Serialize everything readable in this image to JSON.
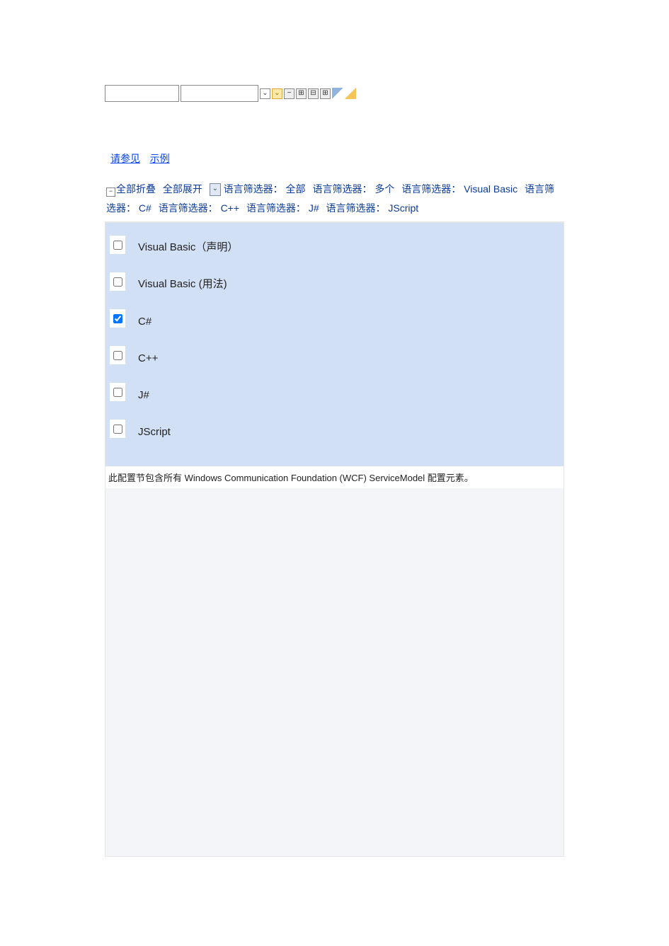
{
  "links": {
    "see_also": "请参见",
    "example": "示例"
  },
  "filters": {
    "collapse_all": "全部折叠",
    "expand_all": "全部展开",
    "filter_prefix": "语言筛选器：",
    "options": [
      "全部",
      "多个",
      "Visual Basic",
      "C#",
      "C++",
      "J#",
      "JScript"
    ]
  },
  "languages": [
    {
      "label": "Visual Basic（声明）",
      "checked": false
    },
    {
      "label": "Visual Basic (用法)",
      "checked": false
    },
    {
      "label": "C#",
      "checked": true
    },
    {
      "label": "C++",
      "checked": false
    },
    {
      "label": "J#",
      "checked": false
    },
    {
      "label": "JScript",
      "checked": false
    }
  ],
  "description": "此配置节包含所有 Windows Communication Foundation (WCF) ServiceModel 配置元素。"
}
